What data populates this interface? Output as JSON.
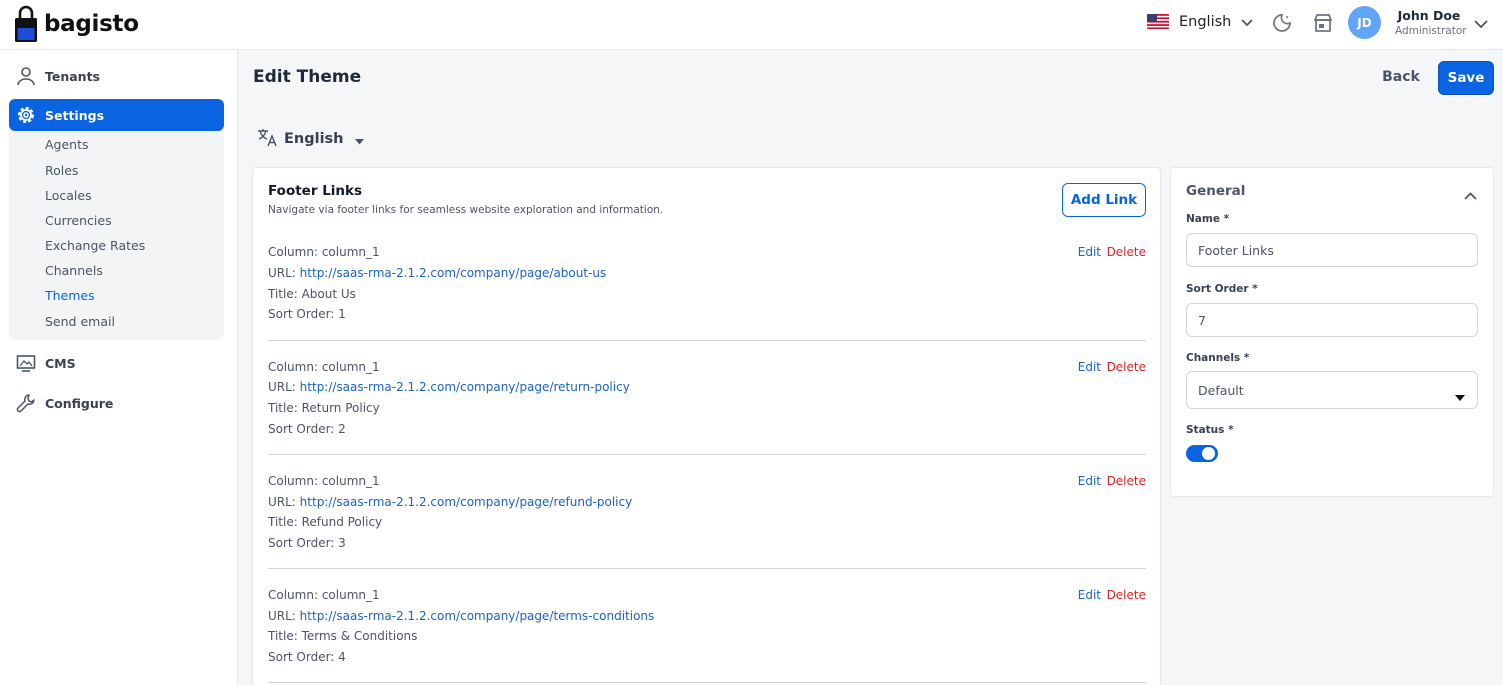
{
  "header": {
    "logo_text": "bagisto",
    "language": "English",
    "user": {
      "initials": "JD",
      "name": "John Doe",
      "role": "Administrator"
    }
  },
  "sidebar": {
    "items": [
      {
        "label": "Tenants",
        "icon": "user-icon"
      },
      {
        "label": "Settings",
        "icon": "gear-icon",
        "active": true
      },
      {
        "label": "CMS",
        "icon": "monitor-icon"
      },
      {
        "label": "Configure",
        "icon": "wrench-icon"
      }
    ],
    "settings_submenu": [
      "Agents",
      "Roles",
      "Locales",
      "Currencies",
      "Exchange Rates",
      "Channels",
      "Themes",
      "Send email"
    ],
    "current_submenu": "Themes"
  },
  "page": {
    "title": "Edit Theme",
    "back_label": "Back",
    "save_label": "Save",
    "locale": "English"
  },
  "footer_links": {
    "title": "Footer Links",
    "description": "Navigate via footer links for seamless website exploration and information.",
    "add_label": "Add Link",
    "edit_label": "Edit",
    "delete_label": "Delete",
    "links": [
      {
        "column": "Column: column_1",
        "url_prefix": "URL: ",
        "url": "http://saas-rma-2.1.2.com/company/page/about-us",
        "title": "Title: About Us",
        "sort": "Sort Order: 1"
      },
      {
        "column": "Column: column_1",
        "url_prefix": "URL: ",
        "url": "http://saas-rma-2.1.2.com/company/page/return-policy",
        "title": "Title: Return Policy",
        "sort": "Sort Order: 2"
      },
      {
        "column": "Column: column_1",
        "url_prefix": "URL: ",
        "url": "http://saas-rma-2.1.2.com/company/page/refund-policy",
        "title": "Title: Refund Policy",
        "sort": "Sort Order: 3"
      },
      {
        "column": "Column: column_1",
        "url_prefix": "URL: ",
        "url": "http://saas-rma-2.1.2.com/company/page/terms-conditions",
        "title": "Title: Terms & Conditions",
        "sort": "Sort Order: 4"
      }
    ]
  },
  "general": {
    "title": "General",
    "name_label": "Name *",
    "name_value": "Footer Links",
    "sort_label": "Sort Order *",
    "sort_value": "7",
    "channels_label": "Channels *",
    "channels_value": "Default",
    "status_label": "Status *",
    "status_on": true
  },
  "colors": {
    "primary": "#0a63e0",
    "link": "#1a62c6",
    "danger": "#dc2626"
  }
}
